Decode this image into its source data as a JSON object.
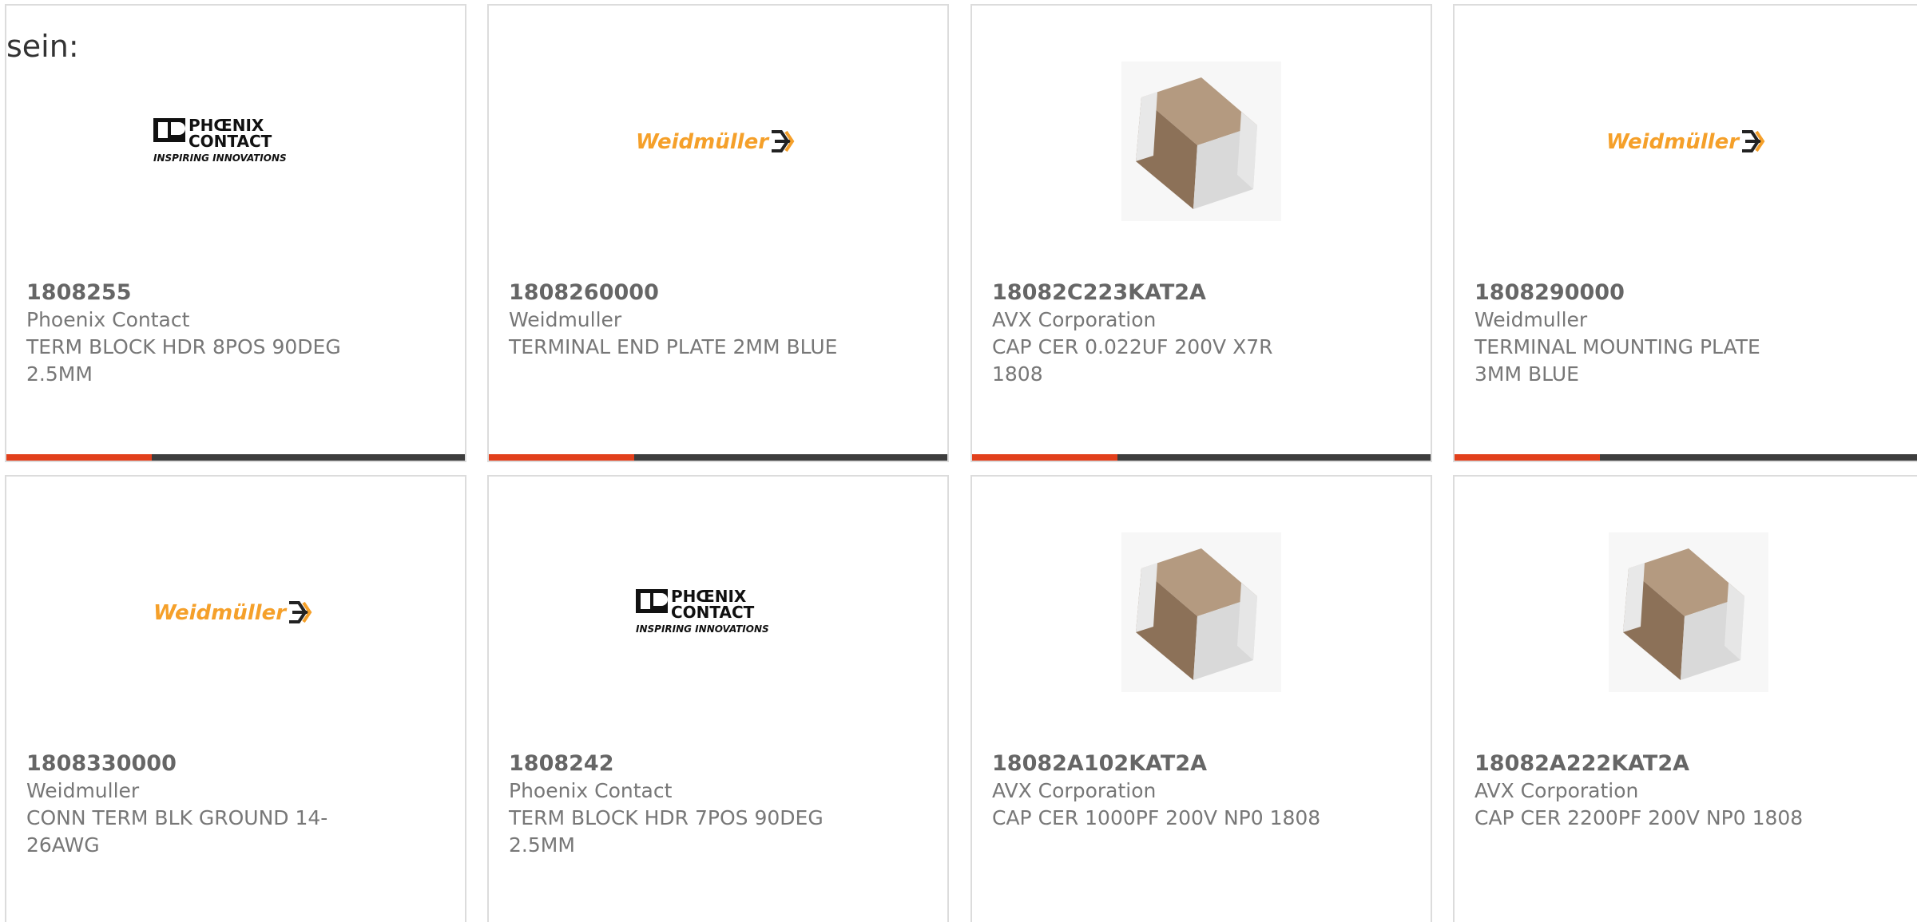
{
  "intro_text": "sein:",
  "colors": {
    "accent_bar": "#e2401c",
    "bar": "#3d3d3d",
    "card_border": "#dcdcdc",
    "weidmuller_orange": "#f5a02a"
  },
  "products": [
    {
      "part_number": "1808255",
      "manufacturer": "Phoenix Contact",
      "description": "TERM BLOCK HDR 8POS 90DEG 2.5MM",
      "image": "phoenix-contact-logo",
      "logo_line1": "PHŒNIX",
      "logo_line2": "CONTACT",
      "logo_tagline": "INSPIRING INNOVATIONS"
    },
    {
      "part_number": "1808260000",
      "manufacturer": "Weidmuller",
      "description": "TERMINAL END PLATE 2MM BLUE",
      "image": "weidmuller-logo",
      "logo_text": "Weidmüller"
    },
    {
      "part_number": "18082C223KAT2A",
      "manufacturer": "AVX Corporation",
      "description": "CAP CER 0.022UF 200V X7R 1808",
      "image": "ceramic-capacitor-image"
    },
    {
      "part_number": "1808290000",
      "manufacturer": "Weidmuller",
      "description": "TERMINAL MOUNTING PLATE 3MM BLUE",
      "image": "weidmuller-logo",
      "logo_text": "Weidmüller"
    },
    {
      "part_number": "1808330000",
      "manufacturer": "Weidmuller",
      "description": "CONN TERM BLK GROUND 14-26AWG",
      "image": "weidmuller-logo",
      "logo_text": "Weidmüller"
    },
    {
      "part_number": "1808242",
      "manufacturer": "Phoenix Contact",
      "description": "TERM BLOCK HDR 7POS 90DEG 2.5MM",
      "image": "phoenix-contact-logo",
      "logo_line1": "PHŒNIX",
      "logo_line2": "CONTACT",
      "logo_tagline": "INSPIRING INNOVATIONS"
    },
    {
      "part_number": "18082A102KAT2A",
      "manufacturer": "AVX Corporation",
      "description": "CAP CER 1000PF 200V NP0 1808",
      "image": "ceramic-capacitor-image"
    },
    {
      "part_number": "18082A222KAT2A",
      "manufacturer": "AVX Corporation",
      "description": "CAP CER 2200PF 200V NP0 1808",
      "image": "ceramic-capacitor-image"
    }
  ]
}
